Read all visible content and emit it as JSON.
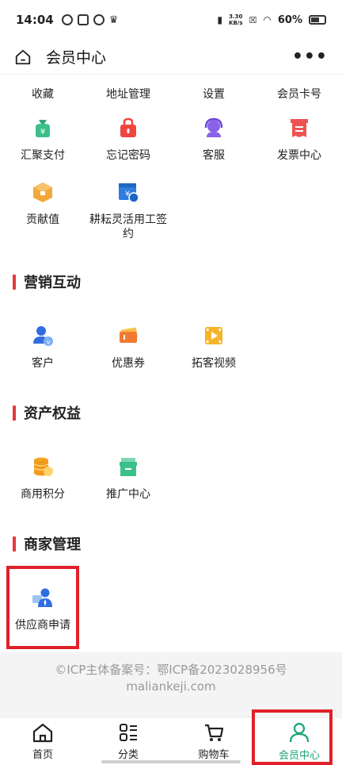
{
  "status_bar": {
    "time": "14:04",
    "net_speed_top": "3.30",
    "net_speed_bottom": "KB/s",
    "battery": "60%"
  },
  "header": {
    "title": "会员中心",
    "more": "•••"
  },
  "top_grid": [
    {
      "label": "收藏"
    },
    {
      "label": "地址管理"
    },
    {
      "label": "设置"
    },
    {
      "label": "会员卡号"
    },
    {
      "label": "汇聚支付",
      "icon": "money-bag-icon",
      "color": "#3cc08a"
    },
    {
      "label": "忘记密码",
      "icon": "lock-bag-icon",
      "color": "#f0453f"
    },
    {
      "label": "客服",
      "icon": "headset-icon",
      "color": "#8a62ea"
    },
    {
      "label": "发票中心",
      "icon": "invoice-icon",
      "color": "#ef5252"
    },
    {
      "label": "贡献值",
      "icon": "box-icon",
      "color": "#f3a93a"
    },
    {
      "label": "耕耘灵活用工签约",
      "icon": "bank-card-icon",
      "color": "#2f7de1"
    }
  ],
  "sections": {
    "marketing": {
      "title": "营销互动",
      "items": [
        {
          "label": "客户",
          "icon": "customer-icon"
        },
        {
          "label": "优惠券",
          "icon": "coupon-icon"
        },
        {
          "label": "拓客视频",
          "icon": "video-icon"
        }
      ]
    },
    "assets": {
      "title": "资产权益",
      "items": [
        {
          "label": "商用积分",
          "icon": "coins-icon"
        },
        {
          "label": "推广中心",
          "icon": "promotion-box-icon"
        }
      ]
    },
    "merchant": {
      "title": "商家管理",
      "items": [
        {
          "label": "供应商申请",
          "icon": "supplier-icon"
        }
      ]
    }
  },
  "footer": {
    "icp": "©ICP主体备案号：鄂ICP备2023028956号",
    "domain": "maliankeji.com"
  },
  "tabbar": [
    {
      "label": "首页",
      "icon": "home-icon"
    },
    {
      "label": "分类",
      "icon": "category-icon"
    },
    {
      "label": "购物车",
      "icon": "cart-icon"
    },
    {
      "label": "会员中心",
      "icon": "user-icon",
      "active": true
    }
  ],
  "colors": {
    "accent_red": "#e4393c",
    "highlight_box": "#e0202a",
    "active_green": "#1aa37a"
  }
}
